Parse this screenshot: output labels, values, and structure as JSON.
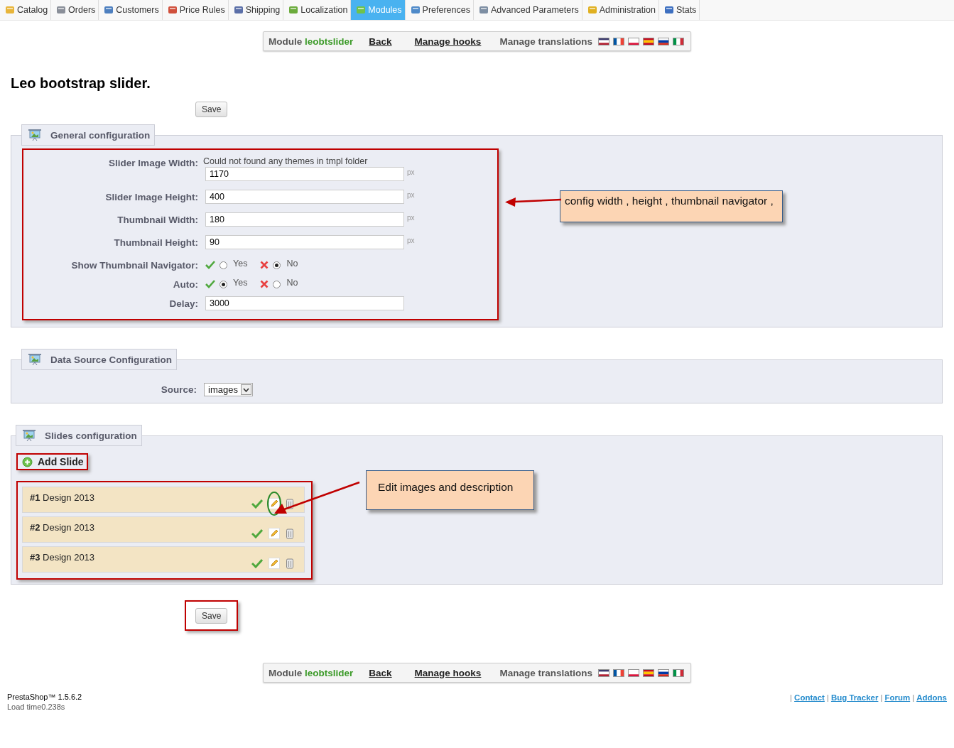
{
  "tabs": [
    {
      "label": "Catalog",
      "selected": false
    },
    {
      "label": "Orders",
      "selected": false
    },
    {
      "label": "Customers",
      "selected": false
    },
    {
      "label": "Price Rules",
      "selected": false
    },
    {
      "label": "Shipping",
      "selected": false
    },
    {
      "label": "Localization",
      "selected": false
    },
    {
      "label": "Modules",
      "selected": true
    },
    {
      "label": "Preferences",
      "selected": false
    },
    {
      "label": "Advanced Parameters",
      "selected": false
    },
    {
      "label": "Administration",
      "selected": false
    },
    {
      "label": "Stats",
      "selected": false
    }
  ],
  "top_toolbar": {
    "module_label": "Module",
    "module_name": "leobtslider",
    "back": "Back",
    "manage_hooks": "Manage hooks",
    "manage_translations": "Manage translations"
  },
  "page_title": "Leo bootstrap slider.",
  "top_save": "Save",
  "general_configuration": {
    "title": "General configuration",
    "fields": [
      {
        "kind": "text",
        "label": "Slider Image Width:",
        "note": "Could not found any themes in tmpl folder",
        "value": "1170",
        "unit": "px"
      },
      {
        "kind": "text",
        "label": "Slider Image Height:",
        "value": "400",
        "unit": "px"
      },
      {
        "kind": "text",
        "label": "Thumbnail Width:",
        "value": "180",
        "unit": "px"
      },
      {
        "kind": "text",
        "label": "Thumbnail Height:",
        "value": "90",
        "unit": "px"
      },
      {
        "kind": "radio",
        "label": "Show Thumbnail Navigator:",
        "options": [
          {
            "kind": "yes",
            "label": "Yes",
            "selected": false
          },
          {
            "kind": "no",
            "label": "No",
            "selected": true
          }
        ]
      },
      {
        "kind": "radio",
        "label": "Auto:",
        "options": [
          {
            "kind": "yes",
            "label": "Yes",
            "selected": true
          },
          {
            "kind": "no",
            "label": "No",
            "selected": false
          }
        ]
      },
      {
        "kind": "text",
        "label": "Delay:",
        "value": "3000"
      }
    ],
    "callout": "config width , height , thumbnail navigator ,"
  },
  "data_source": {
    "title": "Data Source Configuration",
    "label": "Source:",
    "value": "images"
  },
  "slides_configuration": {
    "title": "Slides configuration",
    "add_slide": "Add Slide",
    "slides": [
      {
        "text": "**#1** Design 2013",
        "active": true
      },
      {
        "text": "**#2** Design 2013",
        "active": true
      },
      {
        "text": "**#3** Design 2013",
        "active": true
      }
    ],
    "callout": "Edit images and description"
  },
  "bottom_save": "Save",
  "bottom_toolbar": {
    "module_label": "Module",
    "module_name": "leobtslider",
    "back": "Back",
    "manage_hooks": "Manage hooks",
    "manage_translations": "Manage translations"
  },
  "footer": {
    "version": "PrestaShop™ 1.5.6.2",
    "load_time": "Load time0.238s",
    "links": [
      {
        "kind": "separator",
        "text": "|"
      },
      {
        "kind": "link",
        "text": "Contact"
      },
      {
        "kind": "separator",
        "text": "|"
      },
      {
        "kind": "link",
        "text": "Bug Tracker"
      },
      {
        "kind": "separator",
        "text": "|"
      },
      {
        "kind": "link",
        "text": "Forum"
      },
      {
        "kind": "separator",
        "text": "|"
      },
      {
        "kind": "link",
        "text": "Addons"
      }
    ]
  }
}
